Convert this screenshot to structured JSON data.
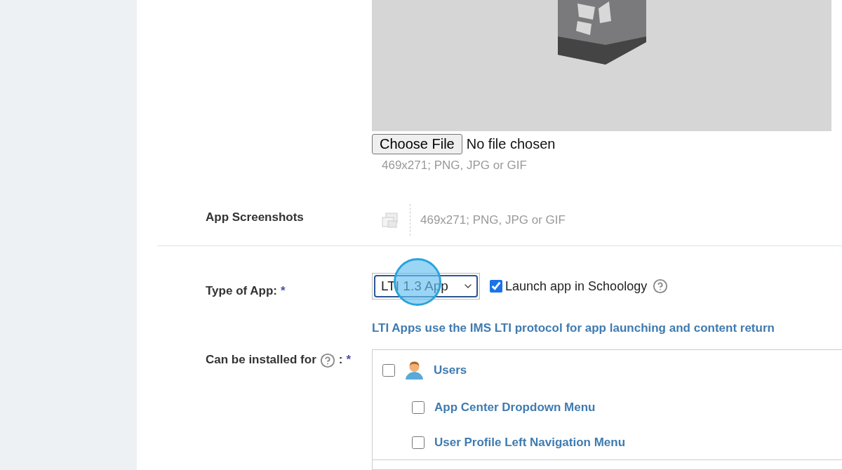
{
  "app_image": {
    "file_button": "Choose File",
    "file_status": "No file chosen",
    "hint": "469x271; PNG, JPG or GIF"
  },
  "screenshots": {
    "label": "App Screenshots",
    "hint": "469x271; PNG, JPG or GIF"
  },
  "app_type": {
    "label": "Type of App:",
    "required": "*",
    "value": "LTI 1.3 App",
    "click_marker": true,
    "launch": {
      "label": "Launch app in Schoology",
      "checked": true
    },
    "note": "LTI Apps use the IMS LTI protocol for app launching and content return"
  },
  "install_for": {
    "label": "Can be installed for",
    "separator": ":",
    "required": "*",
    "options": [
      {
        "label": "Users",
        "checked": false,
        "children": [
          {
            "label": "App Center Dropdown Menu",
            "checked": false
          },
          {
            "label": "User Profile Left Navigation Menu",
            "checked": false
          }
        ]
      }
    ]
  }
}
